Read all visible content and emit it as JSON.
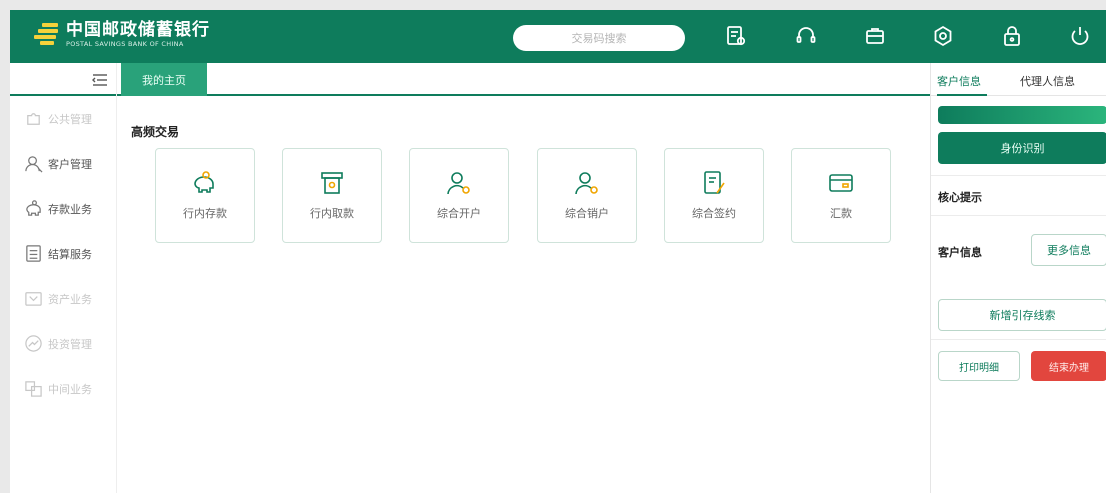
{
  "header": {
    "bank_name_cn": "中国邮政储蓄银行",
    "bank_name_en": "POSTAL SAVINGS BANK OF CHINA",
    "search_placeholder": "交易码搜索",
    "icons": [
      "document-icon",
      "headset-icon",
      "briefcase-icon",
      "settings-icon",
      "lock-icon",
      "power-icon"
    ],
    "brand_color": "#0e7c5c"
  },
  "sidebar": {
    "items": [
      {
        "label": "公共管理",
        "icon": "puzzle-icon",
        "active": false
      },
      {
        "label": "客户管理",
        "icon": "user-icon",
        "active": true
      },
      {
        "label": "存款业务",
        "icon": "piggy-bank-icon",
        "active": true
      },
      {
        "label": "结算服务",
        "icon": "calculator-icon",
        "active": true
      },
      {
        "label": "资产业务",
        "icon": "asset-icon",
        "active": false
      },
      {
        "label": "投资管理",
        "icon": "trend-icon",
        "active": false
      },
      {
        "label": "中间业务",
        "icon": "box-icon",
        "active": false
      }
    ]
  },
  "tabs": {
    "home_label": "我的主页"
  },
  "main": {
    "section_title": "高频交易",
    "cards": [
      {
        "label": "行内存款",
        "icon": "piggy-bank-icon"
      },
      {
        "label": "行内取款",
        "icon": "atm-icon"
      },
      {
        "label": "综合开户",
        "icon": "user-add-icon"
      },
      {
        "label": "综合销户",
        "icon": "user-remove-icon"
      },
      {
        "label": "综合签约",
        "icon": "sign-document-icon"
      },
      {
        "label": "汇款",
        "icon": "card-icon"
      }
    ]
  },
  "right_panel": {
    "tab_customer": "客户信息",
    "tab_agent": "代理人信息",
    "id_button": "身份识别",
    "core_tip_label": "核心提示",
    "customer_info_label": "客户信息",
    "more_info_button": "更多信息",
    "new_clue_button": "新增引存线索",
    "print_button": "打印明细",
    "end_button": "结束办理",
    "accent_red": "#e2463e"
  }
}
